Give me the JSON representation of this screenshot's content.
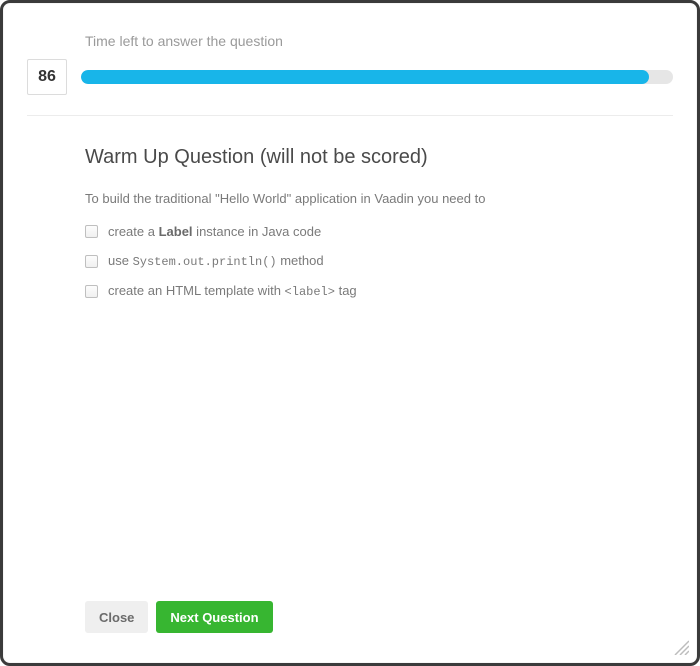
{
  "timer": {
    "label": "Time left to answer the question",
    "remaining": "86",
    "progress_percent": 96
  },
  "question": {
    "title": "Warm Up Question (will not be scored)",
    "prompt": "To build the traditional \"Hello World\" application in Vaadin you need to",
    "options": [
      {
        "pre": "create a ",
        "bold": "Label",
        "post": " instance in Java code"
      },
      {
        "pre": "use ",
        "code": "System.out.println()",
        "post": " method"
      },
      {
        "pre": "create an HTML template with ",
        "code": "<label>",
        "post": " tag"
      }
    ]
  },
  "footer": {
    "close_label": "Close",
    "next_label": "Next Question"
  }
}
